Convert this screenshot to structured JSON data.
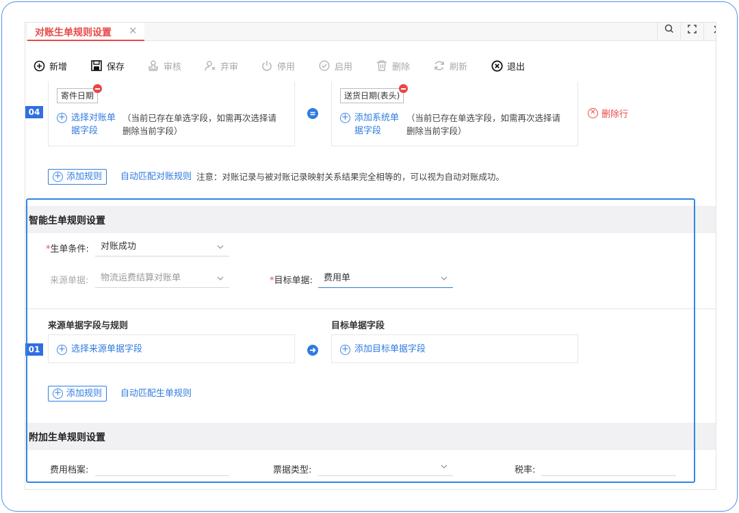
{
  "tab": {
    "title": "对账生单规则设置",
    "close_glyph": "✕"
  },
  "toolbar": [
    {
      "label": "新增",
      "icon": "plus-circle-icon",
      "enabled": true
    },
    {
      "label": "保存",
      "icon": "save-icon",
      "enabled": true
    },
    {
      "label": "审核",
      "icon": "stamp-icon",
      "enabled": false
    },
    {
      "label": "弃审",
      "icon": "user-x-icon",
      "enabled": false
    },
    {
      "label": "停用",
      "icon": "power-icon",
      "enabled": false
    },
    {
      "label": "启用",
      "icon": "check-circle-icon",
      "enabled": false
    },
    {
      "label": "删除",
      "icon": "trash-icon",
      "enabled": false
    },
    {
      "label": "刷新",
      "icon": "refresh-icon",
      "enabled": false
    },
    {
      "label": "退出",
      "icon": "close-circle-icon",
      "enabled": true
    }
  ],
  "match_rule": {
    "row_no": "04",
    "left_chip": "寄件日期",
    "left_add_line1": "选择对账单",
    "left_add_line2": "据字段",
    "left_hint_line1": "（当前已存在单选字段，如需再次选择请",
    "left_hint_line2": "删除当前字段）",
    "right_chip": "送货日期(表头)",
    "right_add_line1": "添加系统单",
    "right_add_line2": "据字段",
    "right_hint_line1": "（当前已存在单选字段，如需再次选择请",
    "right_hint_line2": "删除当前字段）",
    "delete_row": "删除行",
    "add_rule": "添加规则",
    "auto_match": "自动匹配对账规则",
    "note": "注意：对账记录与被对账记录映射关系结果完全相等的，可以视为自动对账成功。"
  },
  "smart": {
    "title": "智能生单规则设置",
    "cond_label": "生单条件:",
    "cond_value": "对账成功",
    "source_label": "来源单据:",
    "source_value": "物流运费结算对账单",
    "target_label": "目标单据:",
    "target_value": "费用单",
    "src_fields_title": "来源单据字段与规则",
    "tgt_fields_title": "目标单据字段",
    "row_no": "01",
    "select_src": "选择来源单据字段",
    "add_tgt": "添加目标单据字段",
    "add_rule": "添加规则",
    "auto_match": "自动匹配生单规则"
  },
  "extra": {
    "title": "附加生单规则设置",
    "fee_label": "费用档案:",
    "bill_type_label": "票据类型:",
    "tax_label": "税率:"
  },
  "colors": {
    "accent": "#2f7be0",
    "danger": "#e94848",
    "highlight": "#2d86e6"
  }
}
